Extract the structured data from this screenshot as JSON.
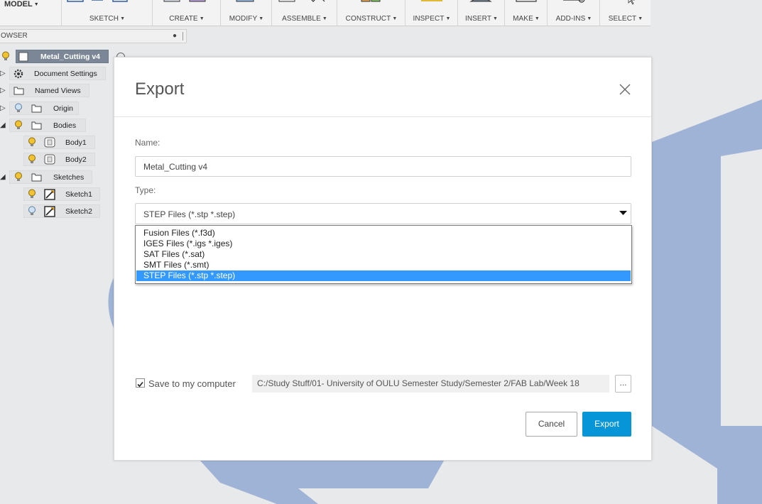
{
  "colors": {
    "accent": "#0696d7",
    "selection": "#3399ff",
    "canvas_shape": "#9fb3d6",
    "bulb": "#f1c232"
  },
  "toolbar": {
    "workspace": "MODEL",
    "groups": [
      {
        "label": "SKETCH"
      },
      {
        "label": "CREATE"
      },
      {
        "label": "MODIFY"
      },
      {
        "label": "ASSEMBLE"
      },
      {
        "label": "CONSTRUCT"
      },
      {
        "label": "INSPECT"
      },
      {
        "label": "INSERT"
      },
      {
        "label": "MAKE"
      },
      {
        "label": "ADD-INS"
      },
      {
        "label": "SELECT"
      }
    ]
  },
  "browser": {
    "title": "OWSER",
    "root": "Metal_Cutting v4",
    "items": [
      {
        "label": "Document Settings",
        "icon": "gear-icon"
      },
      {
        "label": "Named Views",
        "icon": "folder-icon"
      },
      {
        "label": "Origin",
        "icon": "folder-icon"
      },
      {
        "label": "Bodies",
        "icon": "folder-icon"
      },
      {
        "label": "Body1",
        "icon": "body-icon"
      },
      {
        "label": "Body2",
        "icon": "body-icon"
      },
      {
        "label": "Sketches",
        "icon": "folder-icon"
      },
      {
        "label": "Sketch1",
        "icon": "sketch-icon"
      },
      {
        "label": "Sketch2",
        "icon": "sketch-icon"
      }
    ]
  },
  "dialog": {
    "title": "Export",
    "name_label": "Name:",
    "name_value": "Metal_Cutting v4",
    "type_label": "Type:",
    "type_selected": "STEP Files (*.stp *.step)",
    "type_options": [
      "Fusion Files (*.f3d)",
      "IGES Files (*.igs *.iges)",
      "SAT Files (*.sat)",
      "SMT Files (*.smt)",
      "STEP Files (*.stp *.step)"
    ],
    "save_to_computer_label": "Save to my computer",
    "save_to_computer_checked": true,
    "save_path": "C:/Study Stuff/01- University of OULU Semester Study/Semester 2/FAB Lab/Week 18",
    "browse_label": "...",
    "cancel_label": "Cancel",
    "export_label": "Export"
  }
}
